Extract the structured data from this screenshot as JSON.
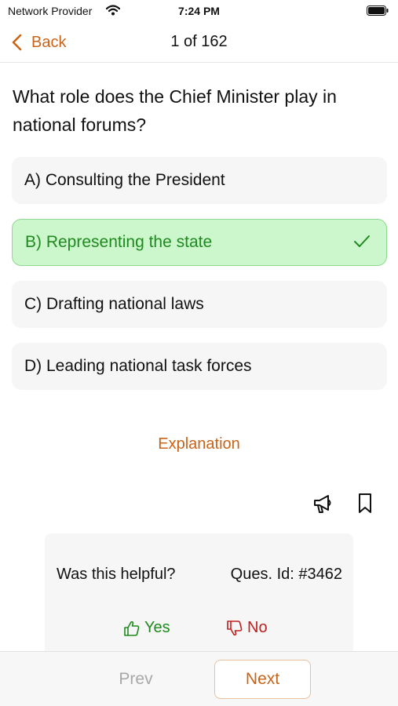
{
  "status_bar": {
    "carrier": "Network Provider",
    "time": "7:24 PM",
    "wifi_icon": "wifi-icon",
    "battery_icon": "battery-icon"
  },
  "nav": {
    "back_label": "Back",
    "title": "1 of 162"
  },
  "question": {
    "text": "What role does the Chief Minister play in national forums?"
  },
  "options": [
    {
      "label": "A) Consulting the President",
      "correct": false
    },
    {
      "label": "B) Representing the state",
      "correct": true
    },
    {
      "label": "C) Drafting national laws",
      "correct": false
    },
    {
      "label": "D) Leading national task forces",
      "correct": false
    }
  ],
  "explanation_label": "Explanation",
  "actions": {
    "report_icon": "megaphone-icon",
    "bookmark_icon": "bookmark-icon"
  },
  "feedback": {
    "prompt": "Was this helpful?",
    "question_id": "Ques. Id: #3462",
    "yes_label": "Yes",
    "no_label": "No"
  },
  "footer": {
    "prev_label": "Prev",
    "next_label": "Next"
  },
  "colors": {
    "accent": "#c8641a",
    "correct_bg": "#ccf7cc",
    "correct_text": "#1f8a1f",
    "no_red": "#c0201e"
  }
}
